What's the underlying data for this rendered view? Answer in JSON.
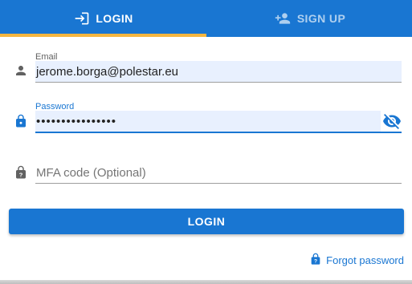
{
  "tabs": {
    "login": {
      "label": "LOGIN",
      "icon": "login-icon",
      "active": true
    },
    "signup": {
      "label": "SIGN UP",
      "icon": "person-add-icon",
      "active": false
    }
  },
  "colors": {
    "primary": "#1976d2",
    "tab_indicator": "#f5b640",
    "autofill_bg": "#e8f0fe"
  },
  "form": {
    "email": {
      "label": "Email",
      "value": "jerome.borga@polestar.eu",
      "icon": "person-icon"
    },
    "password": {
      "label": "Password",
      "value": "••••••••••••••••",
      "icon": "lock-icon",
      "toggle_icon": "visibility-off-icon"
    },
    "mfa": {
      "placeholder": "MFA code (Optional)",
      "icon": "lock-question-icon"
    }
  },
  "actions": {
    "login_label": "LOGIN",
    "forgot_label": "Forgot password",
    "forgot_icon": "lock-question-icon"
  }
}
